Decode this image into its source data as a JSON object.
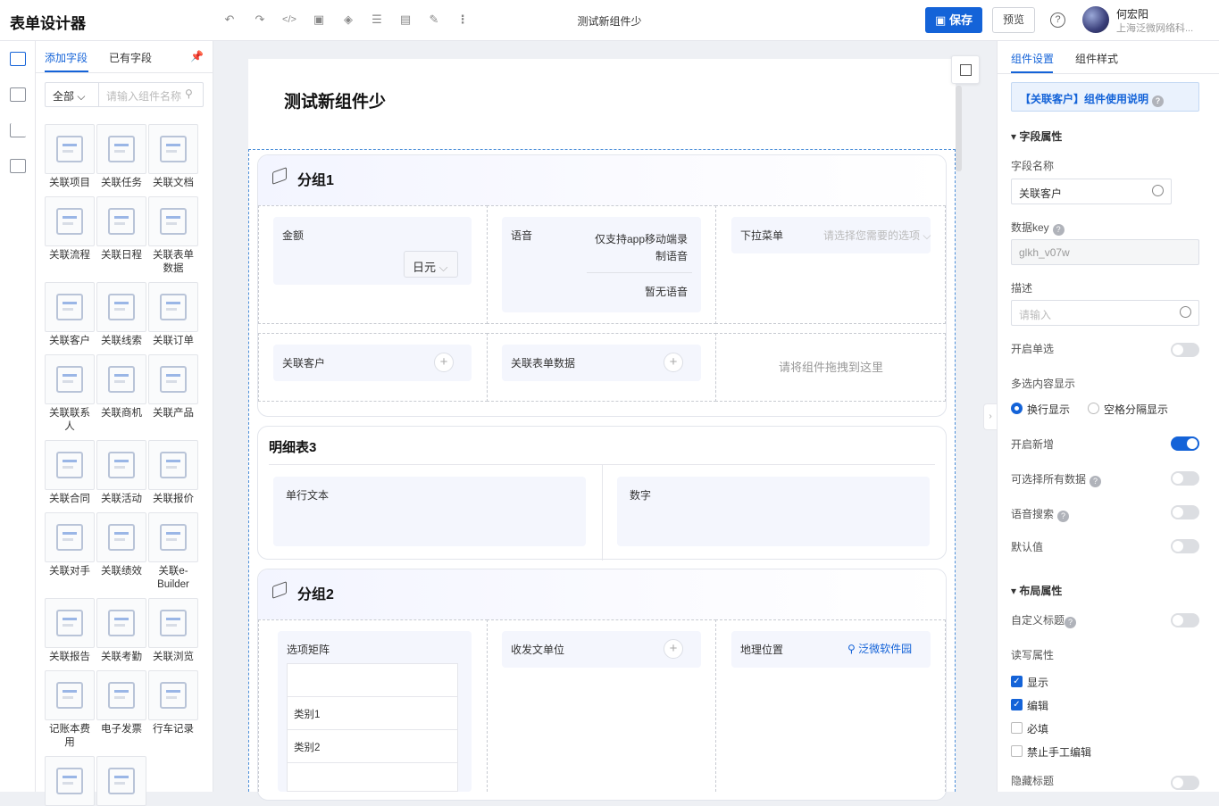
{
  "topbar": {
    "app_title": "表单设计器",
    "doc_title": "测试新组件少",
    "save": "保存",
    "preview": "预览",
    "help": "?",
    "user_name": "何宏阳",
    "user_org": "上海泛微网络科..."
  },
  "field_panel": {
    "tabs": [
      "添加字段",
      "已有字段"
    ],
    "filter_value": "全部",
    "search_placeholder": "请输入组件名称",
    "components": [
      [
        "关联项目"
      ],
      [
        "关联任务"
      ],
      [
        "关联文档"
      ],
      [
        "关联流程"
      ],
      [
        "关联日程"
      ],
      [
        "关联表单",
        "数据"
      ],
      [
        "关联客户"
      ],
      [
        "关联线索"
      ],
      [
        "关联订单"
      ],
      [
        "关联联系",
        "人"
      ],
      [
        "关联商机"
      ],
      [
        "关联产品"
      ],
      [
        "关联合同"
      ],
      [
        "关联活动"
      ],
      [
        "关联报价"
      ],
      [
        "关联对手"
      ],
      [
        "关联绩效"
      ],
      [
        "关联e-",
        "Builder"
      ],
      [
        "关联报告"
      ],
      [
        "关联考勤"
      ],
      [
        "关联浏览"
      ],
      [
        "记账本费",
        "用"
      ],
      [
        "电子发票"
      ],
      [
        "行车记录"
      ],
      [
        ""
      ],
      [
        ""
      ]
    ]
  },
  "canvas": {
    "form_title": "测试新组件少",
    "group1": {
      "title": "分组1",
      "amount_label": "金额",
      "currency": "日元",
      "voice_label": "语音",
      "voice_note": [
        "仅支持app移动端录",
        "制语音"
      ],
      "voice_empty": "暂无语音",
      "dropdown_label": "下拉菜单",
      "dropdown_placeholder": "请选择您需要的选项",
      "customer_label": "关联客户",
      "form_data_label": "关联表单数据",
      "drop_hint": "请将组件拖拽到这里"
    },
    "detail": {
      "title": "明细表3",
      "col1": "单行文本",
      "col2": "数字"
    },
    "group2": {
      "title": "分组2",
      "matrix_label": "选项矩阵",
      "matrix_rows": [
        "类别1",
        "类别2"
      ],
      "sender_label": "收发文单位",
      "geo_label": "地理位置",
      "geo_value": "泛微软件园"
    }
  },
  "props": {
    "tabs": [
      "组件设置",
      "组件样式"
    ],
    "banner": "【关联客户】组件使用说明",
    "field_section": "字段属性",
    "field_name_label": "字段名称",
    "field_name_value": "关联客户",
    "data_key_label": "数据key",
    "data_key_value": "glkh_v07w",
    "desc_label": "描述",
    "desc_placeholder": "请输入",
    "single_select": "开启单选",
    "multi_display": "多选内容显示",
    "radio_wrap": "换行显示",
    "radio_space": "空格分隔显示",
    "enable_add": "开启新增",
    "select_all": "可选择所有数据",
    "voice_search": "语音搜索",
    "default_value": "默认值",
    "layout_section": "布局属性",
    "custom_title": "自定义标题",
    "rw_label": "读写属性",
    "rw_options": [
      "显示",
      "编辑",
      "必填",
      "禁止手工编辑"
    ],
    "hide_title": "隐藏标题"
  }
}
